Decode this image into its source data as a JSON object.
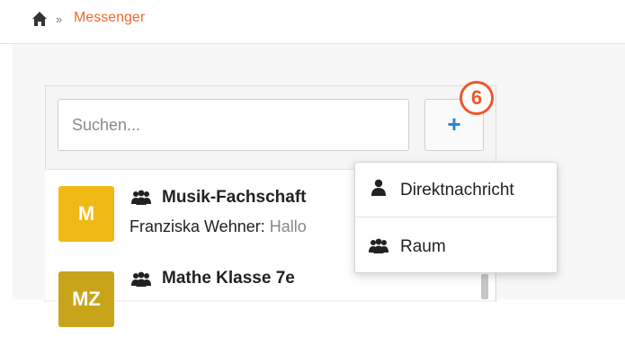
{
  "breadcrumb": {
    "separator": "»",
    "current": "Messenger"
  },
  "search": {
    "placeholder": "Suchen...",
    "value": ""
  },
  "add_button": {
    "label": "+",
    "accent_color": "#2a7fd6"
  },
  "annotation": {
    "number": "6",
    "color": "#f0562a"
  },
  "chats": [
    {
      "avatar_letters": "M",
      "avatar_color": "#f0b915",
      "icon": "users-icon",
      "name": "Musik-Fachschaft",
      "sender": "Franziska Wehner:",
      "message": " Hallo"
    },
    {
      "avatar_letters": "MZ",
      "avatar_color": "#c8a41a",
      "icon": "users-icon",
      "name": "Mathe Klasse 7e"
    }
  ],
  "dropdown": {
    "items": [
      {
        "label": "Direktnachricht",
        "icon": "user-icon"
      },
      {
        "label": "Raum",
        "icon": "users-icon"
      }
    ]
  },
  "colors": {
    "brand_orange": "#f0692a",
    "background": "#f7f7f7"
  }
}
